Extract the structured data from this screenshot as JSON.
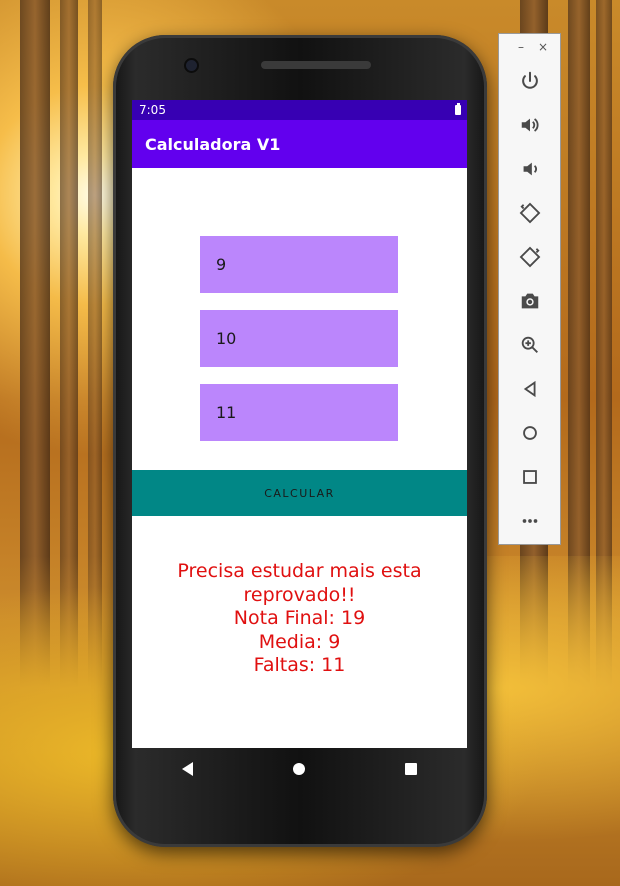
{
  "status_bar": {
    "time": "7:05"
  },
  "app": {
    "title": "Calculadora V1",
    "fields": [
      {
        "value": "9"
      },
      {
        "value": "10"
      },
      {
        "value": "11"
      }
    ],
    "calc_button_label": "CALCULAR",
    "result_lines": [
      "Precisa estudar mais esta",
      "reprovado!!",
      "Nota Final: 19",
      "Media: 9",
      "Faltas: 11"
    ],
    "colors": {
      "status_bar": "#3700b3",
      "app_bar": "#6200ee",
      "field_bg": "#bb86fc",
      "button_bg": "#018786",
      "result_text": "#e01010"
    }
  },
  "navigation": {
    "icons": [
      "back-icon",
      "home-icon",
      "recents-icon"
    ]
  },
  "emulator_panel": {
    "window_controls": {
      "minimize": "–",
      "close": "×"
    },
    "tools": [
      "power-icon",
      "volume-up-icon",
      "volume-down-icon",
      "rotate-left-icon",
      "rotate-right-icon",
      "camera-icon",
      "zoom-icon",
      "back-icon",
      "home-icon",
      "overview-icon",
      "more-icon"
    ]
  }
}
